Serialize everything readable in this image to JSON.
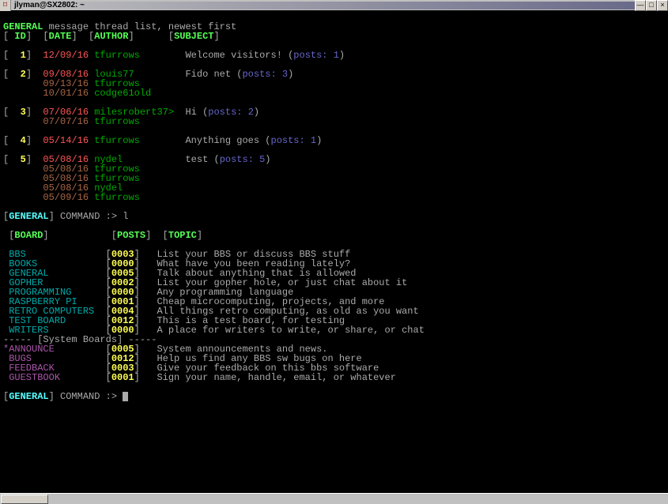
{
  "window": {
    "title": "jlyman@SX2802: ~",
    "buttons": {
      "min": "—",
      "max": "□",
      "close": "×"
    }
  },
  "header": {
    "board": "GENERAL",
    "subtitle": "message thread list, newest first",
    "cols": {
      "id": "ID",
      "date": "DATE",
      "author": "AUTHOR",
      "subject": "SUBJECT"
    }
  },
  "threads": [
    {
      "id": "1",
      "date": "12/09/16",
      "author": "tfurrows",
      "subject": "Welcome visitors!",
      "posts": "1",
      "replies": []
    },
    {
      "id": "2",
      "date": "09/08/16",
      "author": "louis77",
      "subject": "Fido net",
      "posts": "3",
      "replies": [
        {
          "date": "09/13/16",
          "author": "tfurrows"
        },
        {
          "date": "10/01/16",
          "author": "codge61old"
        }
      ]
    },
    {
      "id": "3",
      "date": "07/06/16",
      "author": "milesrobert37>",
      "subject": "Hi",
      "posts": "2",
      "replies": [
        {
          "date": "07/07/16",
          "author": "tfurrows"
        }
      ]
    },
    {
      "id": "4",
      "date": "05/14/16",
      "author": "tfurrows",
      "subject": "Anything goes",
      "posts": "1",
      "replies": []
    },
    {
      "id": "5",
      "date": "05/08/16",
      "author": "nydel",
      "subject": "test",
      "posts": "5",
      "replies": [
        {
          "date": "05/08/16",
          "author": "tfurrows"
        },
        {
          "date": "05/08/16",
          "author": "tfurrows"
        },
        {
          "date": "05/08/16",
          "author": "nydel"
        },
        {
          "date": "05/09/16",
          "author": "tfurrows"
        }
      ]
    }
  ],
  "prompt1": {
    "board": "GENERAL",
    "label": "COMMAND :>",
    "input": "l"
  },
  "board_header": {
    "board": "BOARD",
    "posts": "POSTS",
    "topic": "TOPIC"
  },
  "boards": [
    {
      "name": "BBS",
      "posts": "0003",
      "topic": "List your BBS or discuss BBS stuff"
    },
    {
      "name": "BOOKS",
      "posts": "0000",
      "topic": "What have you been reading lately?"
    },
    {
      "name": "GENERAL",
      "posts": "0005",
      "topic": "Talk about anything that is allowed"
    },
    {
      "name": "GOPHER",
      "posts": "0002",
      "topic": "List your gopher hole, or just chat about it"
    },
    {
      "name": "PROGRAMMING",
      "posts": "0000",
      "topic": "Any programming language"
    },
    {
      "name": "RASPBERRY PI",
      "posts": "0001",
      "topic": "Cheap microcomputing, projects, and more"
    },
    {
      "name": "RETRO COMPUTERS",
      "posts": "0004",
      "topic": "All things retro computing, as old as you want"
    },
    {
      "name": "TEST BOARD",
      "posts": "0012",
      "topic": "This is a test board, for testing"
    },
    {
      "name": "WRITERS",
      "posts": "0000",
      "topic": "A place for writers to write, or share, or chat"
    }
  ],
  "system_divider": "[System Boards]",
  "system_boards": [
    {
      "marker": "*",
      "name": "ANNOUNCE",
      "posts": "0005",
      "topic": "System announcements and news."
    },
    {
      "marker": " ",
      "name": "BUGS",
      "posts": "0012",
      "topic": "Help us find any BBS sw bugs on here"
    },
    {
      "marker": " ",
      "name": "FEEDBACK",
      "posts": "0003",
      "topic": "Give your feedback on this bbs software"
    },
    {
      "marker": " ",
      "name": "GUESTBOOK",
      "posts": "0001",
      "topic": "Sign your name, handle, email, or whatever"
    }
  ],
  "prompt2": {
    "board": "GENERAL",
    "label": "COMMAND :>"
  },
  "posts_word": "posts:"
}
